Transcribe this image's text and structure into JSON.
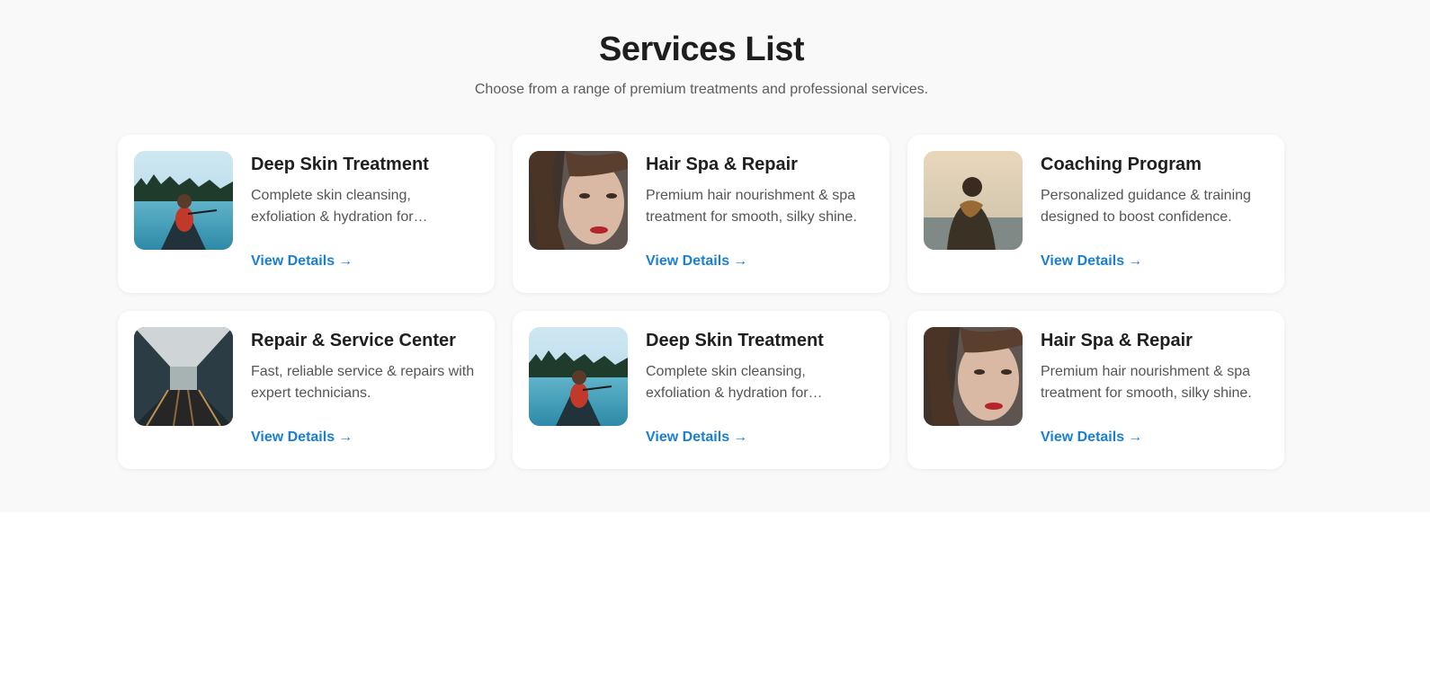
{
  "header": {
    "title": "Services List",
    "subtitle": "Choose from a range of premium treatments and professional services."
  },
  "link_arrow": "→",
  "cards": [
    {
      "title": "Deep Skin Treatment",
      "description": "Complete skin cleansing, exfoliation & hydration for…",
      "link_label": "View Details",
      "image": "woman-in-canoe-lake-photo"
    },
    {
      "title": "Hair Spa & Repair",
      "description": "Premium hair nourishment & spa treatment for smooth, silky shine.",
      "link_label": "View Details",
      "image": "woman-portrait-photo"
    },
    {
      "title": "Coaching Program",
      "description": "Personalized guidance & training designed to boost confidence.",
      "link_label": "View Details",
      "image": "man-at-sunset-sea-photo"
    },
    {
      "title": "Repair & Service Center",
      "description": "Fast, reliable service & repairs with expert technicians.",
      "link_label": "View Details",
      "image": "escalator-corridor-photo"
    },
    {
      "title": "Deep Skin Treatment",
      "description": "Complete skin cleansing, exfoliation & hydration for…",
      "link_label": "View Details",
      "image": "woman-in-canoe-lake-photo"
    },
    {
      "title": "Hair Spa & Repair",
      "description": "Premium hair nourishment & spa treatment for smooth, silky shine.",
      "link_label": "View Details",
      "image": "woman-portrait-photo"
    }
  ],
  "colors": {
    "accent_link": "#1a7fd4",
    "section_background": "#f9f9f9",
    "card_background": "#ffffff"
  }
}
